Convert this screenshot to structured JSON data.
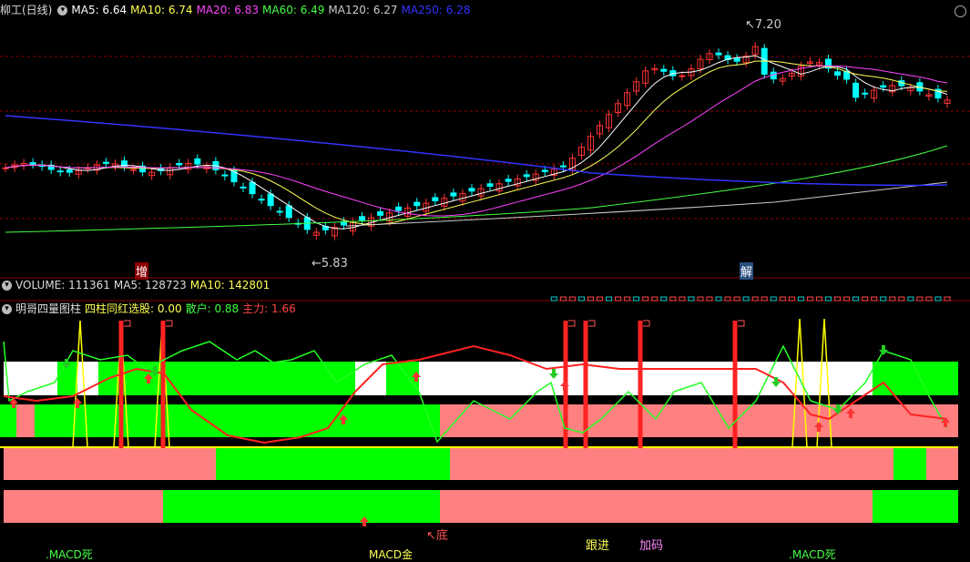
{
  "main_header": {
    "title": "柳工(日线)",
    "ma": [
      {
        "label": "MA5: 6.64",
        "color": "#ffffff"
      },
      {
        "label": "MA10: 6.74",
        "color": "#ffff55"
      },
      {
        "label": "MA20: 6.83",
        "color": "#ff44ff"
      },
      {
        "label": "MA60: 6.49",
        "color": "#44ff44"
      },
      {
        "label": "MA120: 6.27",
        "color": "#cccccc"
      },
      {
        "label": "MA250: 6.28",
        "color": "#3333ff"
      }
    ]
  },
  "price_marks": {
    "high": "7.20",
    "low": "5.83"
  },
  "signal_marks": {
    "zeng": "增",
    "jie": "解"
  },
  "volume_header": {
    "title": "VOLUME: 111361",
    "ma5": "MA5: 128723",
    "ma10": "MA10: 142801"
  },
  "indicator_header": {
    "title": "明哥四量图柱",
    "signal": "四柱同红选股: 0.00",
    "sanhu": "散户: 0.88",
    "zhuli": "主力: 1.66"
  },
  "bottom_labels": {
    "macd_dead_1": "MACD死",
    "macd_gold": "MACD金",
    "di": "↖底",
    "genjin": "跟进",
    "jiama": "加码",
    "macd_dead_2": "MACD死"
  },
  "colors": {
    "up": "#ff3333",
    "down": "#00ffff",
    "grid": "#8b0000",
    "green_block": "#00ff00",
    "pink_block": "#ff8080",
    "white_block": "#ffffff",
    "yellow_line": "#ffff00"
  }
}
